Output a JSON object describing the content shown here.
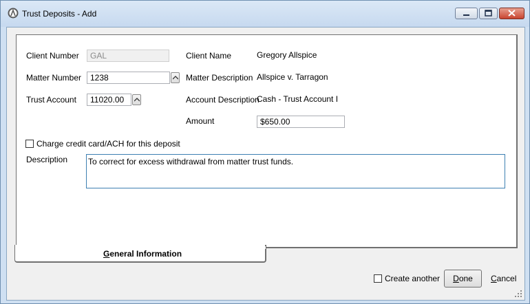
{
  "window": {
    "title": "Trust Deposits - Add"
  },
  "form": {
    "client_number_label": "Client Number",
    "client_number_value": "GAL",
    "matter_number_label": "Matter Number",
    "matter_number_value": "1238",
    "trust_account_label": "Trust Account",
    "trust_account_value": "11020.00",
    "client_name_label": "Client Name",
    "client_name_value": "Gregory Allspice",
    "matter_description_label": "Matter Description",
    "matter_description_value": "Allspice v. Tarragon",
    "account_description_label": "Account Description",
    "account_description_value": "Cash - Trust Account I",
    "amount_label": "Amount",
    "amount_value": "$650.00",
    "charge_checkbox_label": "Charge credit card/ACH for this deposit",
    "description_label": "Description",
    "description_value": "To correct for excess withdrawal from matter trust funds."
  },
  "tabs": {
    "general_first_letter": "G",
    "general_rest": "eneral Information"
  },
  "footer": {
    "create_another_label": "Create another",
    "done_first_letter": "D",
    "done_rest": "one",
    "cancel_first_letter": "C",
    "cancel_rest": "ancel"
  }
}
